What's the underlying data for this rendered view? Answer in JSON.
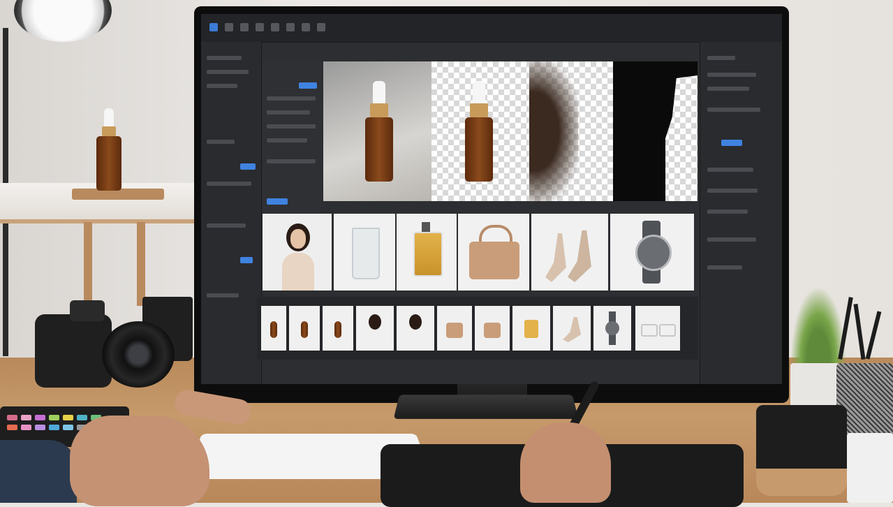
{
  "scene": {
    "description_icons": [
      "desk-scene"
    ],
    "colors": {
      "ui_accent": "#3a7bd5",
      "ui_background": "#2d2e31",
      "desk_wood": "#c69a6b",
      "amber_glass": "#8a4a1c"
    }
  },
  "editor": {
    "toolbar_icons": [
      "move-tool-icon",
      "select-tool-icon",
      "lasso-tool-icon",
      "brush-tool-icon",
      "eraser-tool-icon",
      "crop-tool-icon",
      "zoom-tool-icon",
      "hand-tool-icon"
    ],
    "preview_panes": [
      "original-photo",
      "cutout-transparent",
      "hair-mask",
      "silhouette-mask"
    ],
    "gallery_items": [
      "portrait",
      "glass",
      "perfume",
      "handbag",
      "heels",
      "wristwatch"
    ],
    "filmstrip_items": [
      "bottle",
      "bottle",
      "bottle",
      "portrait",
      "portrait",
      "handbag",
      "handbag",
      "perfume",
      "heels",
      "wristwatch",
      "glasses"
    ]
  }
}
